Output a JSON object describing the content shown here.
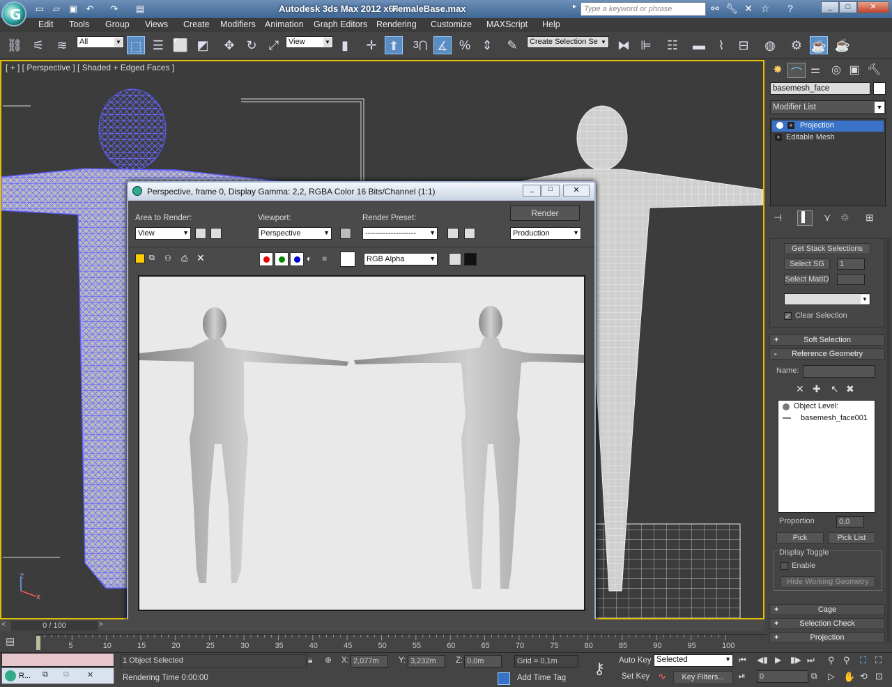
{
  "titlebar": {
    "app_title": "Autodesk 3ds Max  2012 x64",
    "file_name": "FemaleBase.max",
    "search_placeholder": "Type a keyword or phrase"
  },
  "menu": [
    "Edit",
    "Tools",
    "Group",
    "Views",
    "Create",
    "Modifiers",
    "Animation",
    "Graph Editors",
    "Rendering",
    "Customize",
    "MAXScript",
    "Help"
  ],
  "toolbar": {
    "selection_filter": "All",
    "reference_coord": "View",
    "named_selection_placeholder": "Create Selection Se",
    "snap_label": "3"
  },
  "viewport": {
    "label": "[ + ] [ Perspective ] [ Shaded + Edged Faces ]"
  },
  "render_window": {
    "title": "Perspective, frame 0, Display Gamma: 2,2, RGBA Color 16 Bits/Channel (1:1)",
    "area_label": "Area to Render:",
    "area_value": "View",
    "viewport_label": "Viewport:",
    "viewport_value": "Perspective",
    "preset_label": "Render Preset:",
    "preset_value": "--------------------",
    "render_button": "Render",
    "production_value": "Production",
    "channel_value": "RGB Alpha"
  },
  "command_panel": {
    "object_name": "basemesh_face",
    "modifier_list": "Modifier List",
    "stack": [
      "Projection",
      "Editable Mesh"
    ],
    "get_stack": "Get Stack Selections",
    "select_sg": "Select SG",
    "select_sg_value": "1",
    "select_matid": "Select MatID",
    "clear_selection": "Clear Selection",
    "soft_selection": "Soft Selection",
    "reference_geometry": "Reference Geometry",
    "name_label": "Name:",
    "object_level": "Object Level:",
    "ref_object": "basemesh_face001",
    "proportion_label": "Proportion",
    "proportion_value": "0,0",
    "pick": "Pick",
    "pick_list": "Pick List",
    "display_toggle": "Display Toggle",
    "enable": "Enable",
    "hide_working": "Hide Working Geometry",
    "cage": "Cage",
    "selection_check": "Selection Check",
    "projection": "Projection"
  },
  "timeline": {
    "slider": "0 / 100",
    "ticks": [
      "5",
      "10",
      "15",
      "20",
      "25",
      "30",
      "35",
      "40",
      "45",
      "50",
      "55",
      "60",
      "65",
      "70",
      "75",
      "80",
      "85",
      "90",
      "95",
      "100"
    ]
  },
  "status": {
    "taskbar_label": "R...",
    "objects_selected": "1 Object Selected",
    "rendering_time": "Rendering Time  0:00:00",
    "x_label": "X:",
    "x_value": "2,077m",
    "y_label": "Y:",
    "y_value": "3,232m",
    "z_label": "Z:",
    "z_value": "0,0m",
    "grid": "Grid = 0,1m",
    "add_time_tag": "Add Time Tag",
    "auto_key": "Auto Key",
    "auto_key_mode": "Selected",
    "set_key": "Set Key",
    "key_filters": "Key Filters...",
    "frame": "0"
  },
  "colors": {
    "selection_blue": "#5a5aff",
    "viewport_border": "#e4c000",
    "active_item": "#3a72c8"
  }
}
